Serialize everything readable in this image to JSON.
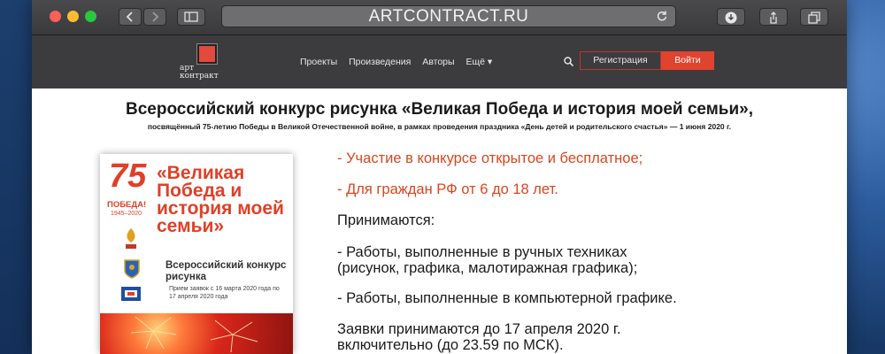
{
  "browser": {
    "address": "ARTCONTRACT.RU"
  },
  "site": {
    "logo_top": "арт",
    "logo_bottom": "контракт",
    "nav": [
      "Проекты",
      "Произведения",
      "Авторы",
      "Ещё ▾"
    ],
    "register": "Регистрация",
    "login": "Войти",
    "accent": "#e0432f"
  },
  "page": {
    "title": "Всероссийский конкурс рисунка «Великая Победа и история моей семьи»,",
    "subtitle": "посвящённый 75-летию Победы в Великой Отечественной войне, в рамках проведения праздника «День детей и родительского счастья» — 1 июня 2020 г."
  },
  "poster": {
    "number": "75",
    "pobedy": "ПОБЕДА!",
    "years": "1945–2020",
    "title": "«Великая Победа и история моей семьи»",
    "subtitle": "Всероссийский конкурс рисунка",
    "dates": "Прием заявок с 16 марта 2020 года по 17 апреля 2020 года"
  },
  "info": {
    "bullet1": "- Участие в конкурсе открытое и бесплатное;",
    "bullet2": "- Для граждан РФ от 6 до 18 лет.",
    "accepted": "Принимаются:",
    "works1_a": "- Работы, выполненные в ручных техниках",
    "works1_b": "(рисунок, графика, малотиражная графика);",
    "works2": "- Работы, выполненные в компьютерной графике.",
    "deadline_a": "Заявки принимаются до 17 апреля 2020 г.",
    "deadline_b": "включительно (до 23.59 по МСК)."
  }
}
